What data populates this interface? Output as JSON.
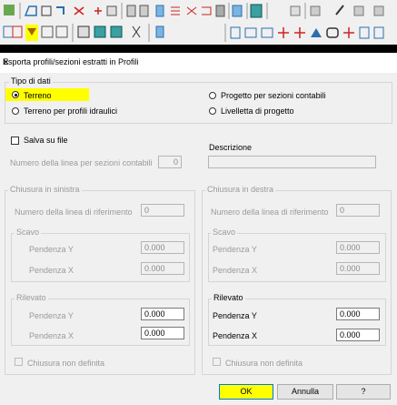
{
  "dialog": {
    "title": "Esporta profili/sezioni estratti in Profili",
    "close_glyph": "×"
  },
  "tipo_dati": {
    "legend": "Tipo di dati",
    "options": [
      {
        "label": "Terreno",
        "selected": true
      },
      {
        "label": "Terreno per profili idraulici",
        "selected": false
      },
      {
        "label": "Progetto per sezioni contabili",
        "selected": false
      },
      {
        "label": "Livelletta di progetto",
        "selected": false
      }
    ]
  },
  "salva_su_file": {
    "label": "Salva su file",
    "checked": false
  },
  "numero_linea_sezioni": {
    "label": "Numero della linea per sezioni contabili",
    "value": "0"
  },
  "descrizione": {
    "label": "Descrizione",
    "value": ""
  },
  "sinistra": {
    "legend": "Chiusura in sinistra",
    "numero_label": "Numero della linea di riferimento",
    "numero_value": "0",
    "scavo": {
      "legend": "Scavo",
      "pendenza_y_label": "Pendenza Y",
      "pendenza_y": "0.000",
      "pendenza_x_label": "Pendenza X",
      "pendenza_x": "0.000"
    },
    "rilevato": {
      "legend": "Rilevato",
      "pendenza_y_label": "Pendenza Y",
      "pendenza_y": "0.000",
      "pendenza_x_label": "Pendenza X",
      "pendenza_x": "0.000"
    },
    "chiusura_non_definita": "Chiusura non definita"
  },
  "destra": {
    "legend": "Chiusura in destra",
    "numero_label": "Numero della linea di riferimento",
    "numero_value": "0",
    "scavo": {
      "legend": "Scavo",
      "pendenza_y_label": "Pendenza Y",
      "pendenza_y": "0.000",
      "pendenza_x_label": "Pendenza X",
      "pendenza_x": "0.000"
    },
    "rilevato": {
      "legend": "Rilevato",
      "pendenza_y_label": "Pendenza Y",
      "pendenza_y": "0.000",
      "pendenza_x_label": "Pendenza X",
      "pendenza_x": "0.000"
    },
    "chiusura_non_definita": "Chiusura non definita"
  },
  "buttons": {
    "ok": "OK",
    "annulla": "Annulla",
    "help": "?"
  },
  "colors": {
    "highlight": "#ffff00",
    "disabled_text": "#9a9a9a"
  }
}
